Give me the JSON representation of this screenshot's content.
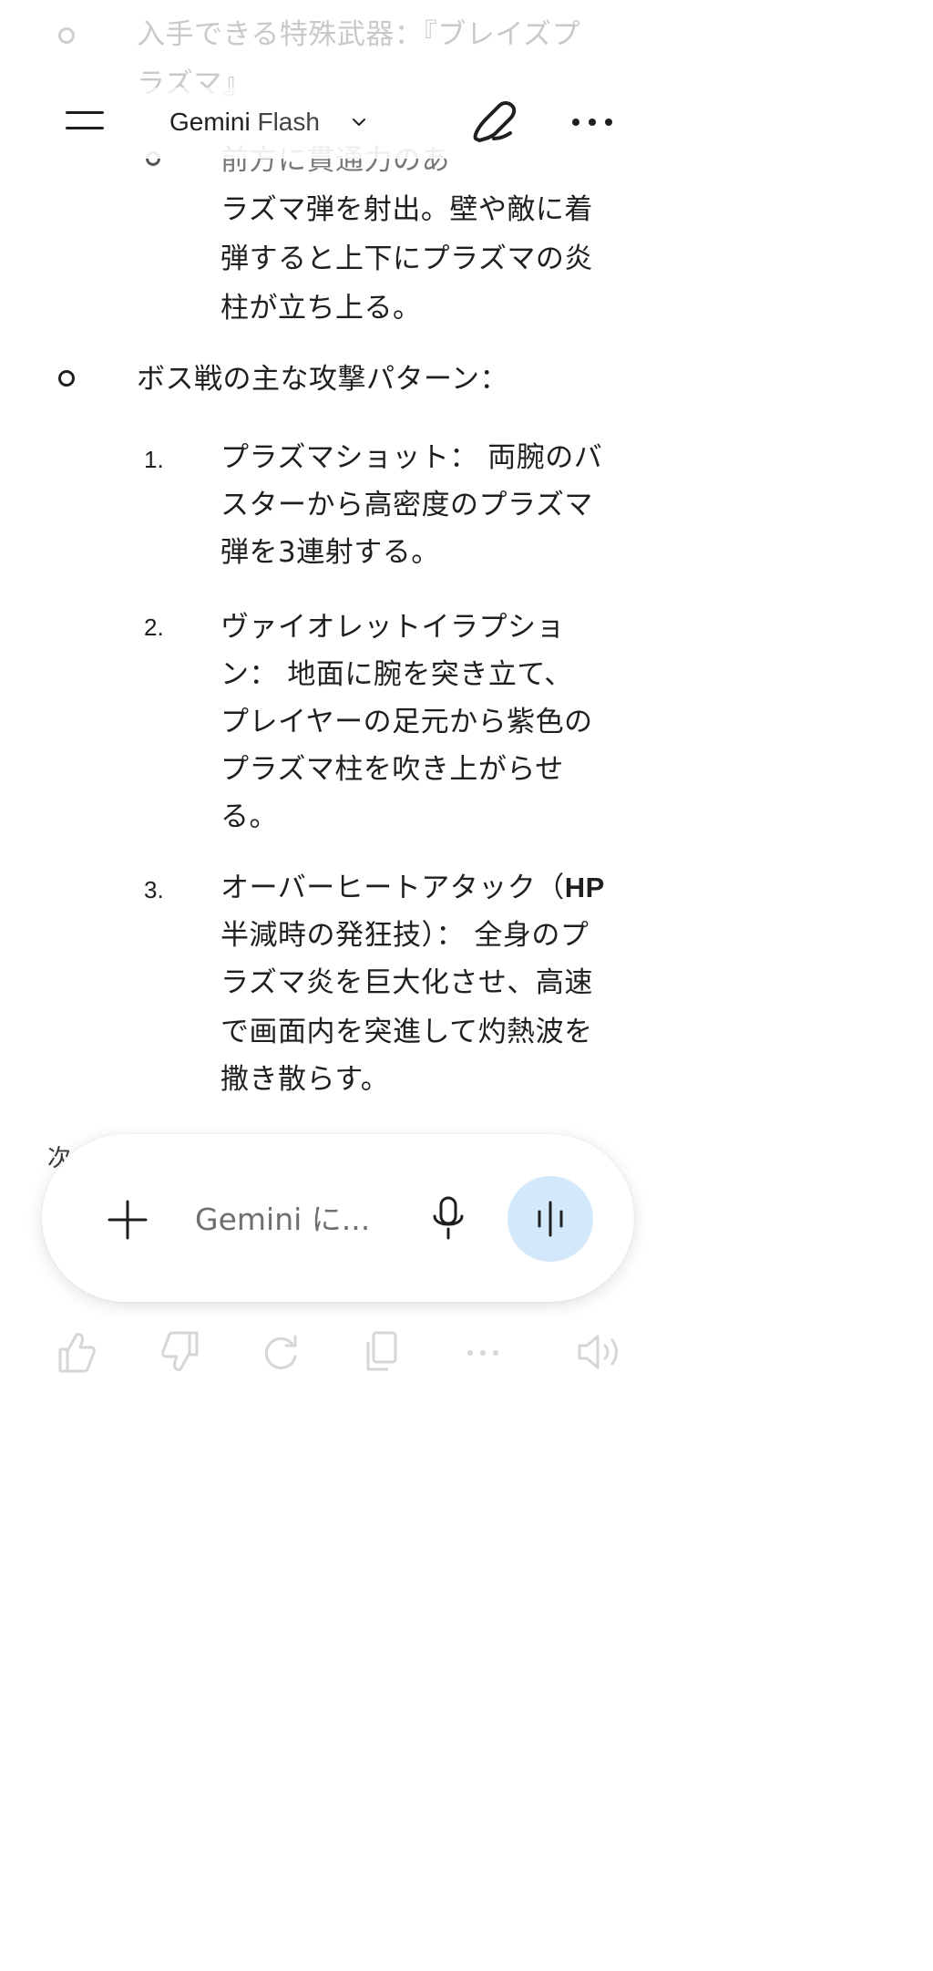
{
  "header": {
    "title_main": "Gemini",
    "title_model": "Flash",
    "menu_icon": "menu-icon",
    "new_chat_icon": "edit-icon",
    "more_icon": "more-vertical-dots-icon"
  },
  "response": {
    "faded_bullet_text_line1": "入手できる特殊武器：『ブレイズプ",
    "faded_bullet_text_line2": "ラズマ』",
    "sub_bullet_line1": "前方に貫通力のあ",
    "sub_bullet_line2": "ラズマ弾を射出。壁や敵に着",
    "sub_bullet_line3": "弾すると上下にプラズマの炎",
    "sub_bullet_line4": "柱が立ち上る。",
    "boss_heading": "ボス戦の主な攻撃パターン：",
    "attacks": [
      {
        "number": "1.",
        "lines": [
          "プラズマショット： 両腕のバ",
          "スターから高密度のプラズマ",
          "弾を3連射する。"
        ]
      },
      {
        "number": "2.",
        "lines": [
          "ヴァイオレットイラプショ",
          "ン： 地面に腕を突き立て、",
          "プレイヤーの足元から紫色の",
          "プラズマ柱を吹き上がらせ",
          "る。"
        ]
      },
      {
        "number": "3.",
        "line1_a": "オーバーヒートアタック（",
        "line1_b": "HP",
        "lines": [
          "半減時の発狂技）： 全身のプ",
          "ラズマ炎を巨大化させ、高速",
          "で画面内を突進して灼熱波を",
          "撒き散らす。"
        ]
      }
    ],
    "peek_text": "次"
  },
  "input": {
    "placeholder": "Gemini に...",
    "add_icon": "plus-icon",
    "mic_icon": "microphone-icon",
    "voice_icon": "voice-waveform-icon",
    "voice_bg": "#d3e9fb"
  },
  "actions": [
    "thumbs-up-icon",
    "thumbs-down-icon",
    "regenerate-icon",
    "copy-icon",
    "more-horizontal-icon",
    "read-aloud-icon"
  ]
}
